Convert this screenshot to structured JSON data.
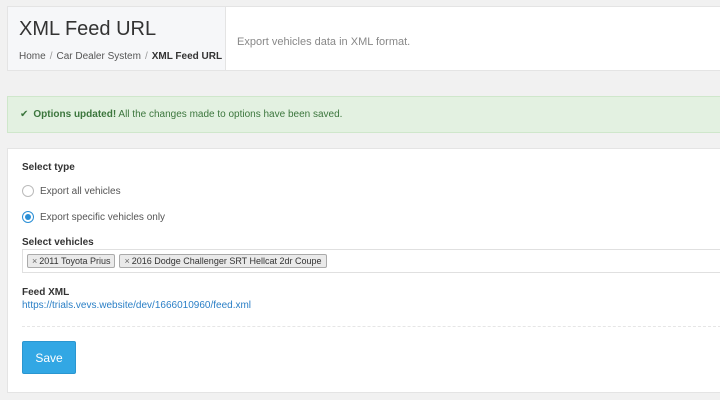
{
  "header": {
    "title": "XML Feed URL",
    "breadcrumb": [
      "Home",
      "Car Dealer System",
      "XML Feed URL"
    ],
    "description": "Export vehicles data in XML format."
  },
  "notice": {
    "icon": "check-icon",
    "strong": "Options updated!",
    "text": "All the changes made to options have been saved."
  },
  "form": {
    "select_type_label": "Select type",
    "options": [
      {
        "label": "Export all vehicles",
        "checked": false
      },
      {
        "label": "Export specific vehicles only",
        "checked": true
      }
    ],
    "select_vehicles_label": "Select vehicles",
    "selected_vehicles": [
      "2011 Toyota Prius",
      "2016 Dodge Challenger SRT Hellcat 2dr Coupe"
    ],
    "feed_label": "Feed XML",
    "feed_url": "https://trials.vevs.website/dev/1666010960/feed.xml",
    "save_label": "Save"
  },
  "colors": {
    "accent": "#32a7e4",
    "success_bg": "#e3f1e1",
    "success_text": "#3c763d",
    "link": "#2a7fc6"
  }
}
